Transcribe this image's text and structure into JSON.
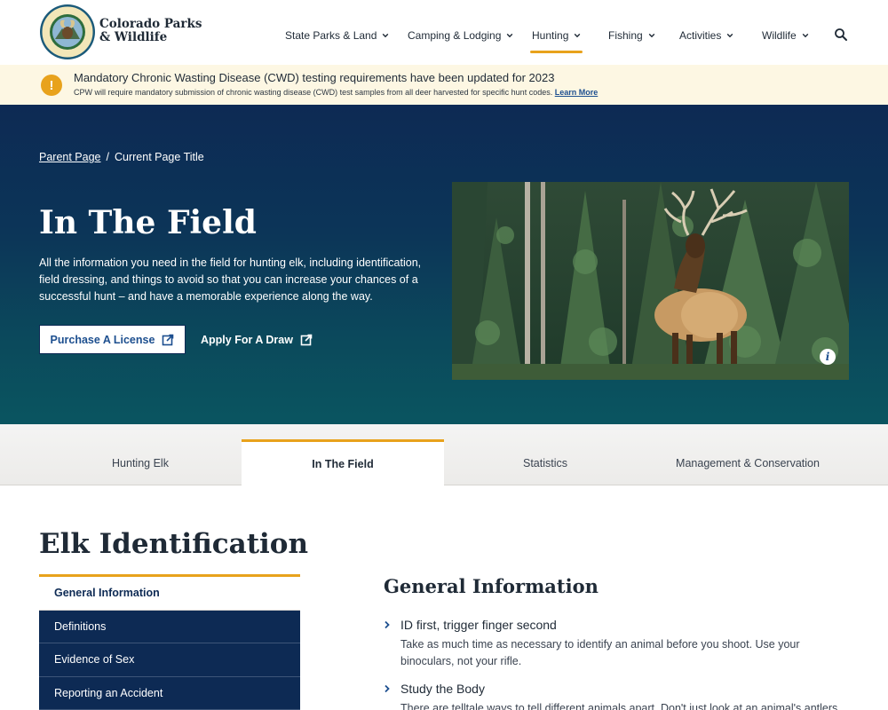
{
  "header": {
    "brand_line1": "Colorado Parks",
    "brand_line2": "& Wildlife",
    "logo_text": "COLORADO PARKS & WILDLIFE",
    "nav": [
      {
        "label": "State Parks & Land"
      },
      {
        "label": "Camping & Lodging"
      },
      {
        "label": "Hunting",
        "active": true
      },
      {
        "label": "Fishing"
      },
      {
        "label": "Activities"
      },
      {
        "label": "Wildlife"
      }
    ],
    "search_icon": "search-icon"
  },
  "alert": {
    "icon": "!",
    "title": "Mandatory Chronic Wasting Disease (CWD) testing requirements have been updated for 2023",
    "text": "CPW will require mandatory submission of chronic wasting disease (CWD) test samples from all deer harvested for specific hunt codes.",
    "link": "Learn More"
  },
  "hero": {
    "breadcrumb_parent": "Parent Page",
    "breadcrumb_sep": "/",
    "breadcrumb_current": "Current Page Title",
    "title": "In The Field",
    "description": "All the information you need in the field for hunting elk, including identification, field dressing, and things to avoid so that you can increase your chances of a successful hunt – and have a memorable experience along the way.",
    "primary_button": "Purchase A License",
    "secondary_button": "Apply For A Draw",
    "info_icon": "i"
  },
  "tabs": [
    {
      "label": "Hunting Elk"
    },
    {
      "label": "In The Field",
      "active": true
    },
    {
      "label": "Statistics"
    },
    {
      "label": "Management & Conservation"
    }
  ],
  "section": {
    "title": "Elk Identification",
    "side_nav": [
      {
        "label": "General Information",
        "active": true
      },
      {
        "label": "Definitions"
      },
      {
        "label": "Evidence of Sex"
      },
      {
        "label": "Reporting an Accident"
      }
    ]
  },
  "content": {
    "title": "General Information",
    "points": [
      {
        "heading": "ID first, trigger finger second",
        "text": "Take as much time as necessary to identify an animal before you shoot. Use your binoculars, not your rifle."
      },
      {
        "heading": "Study the Body",
        "text": "There are telltale ways to tell different animals apart. Don't just look at an animal's antlers."
      }
    ]
  },
  "colors": {
    "navy": "#0d2a54",
    "gold": "#e8a21c",
    "link": "#1d4f8f",
    "alert_bg": "#fdf7e3"
  }
}
